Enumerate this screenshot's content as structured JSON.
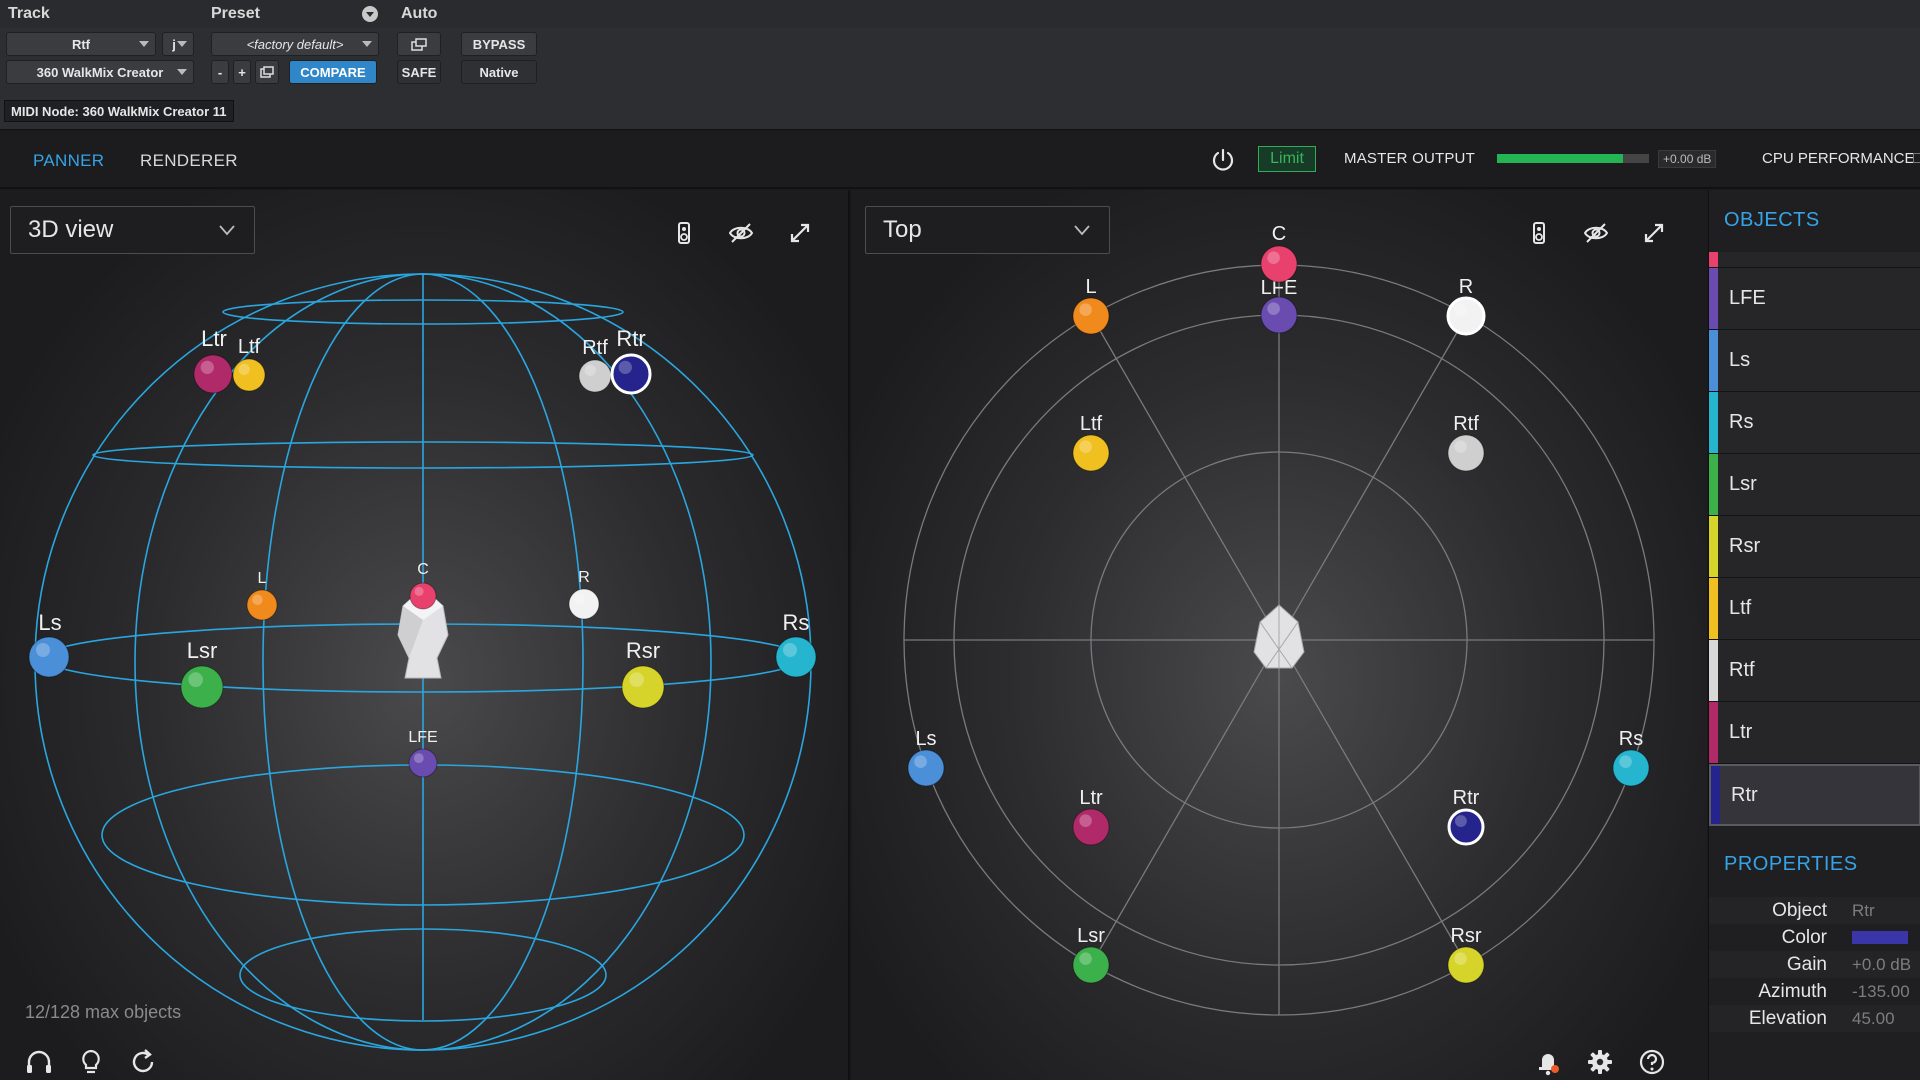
{
  "host": {
    "labels": {
      "track": "Track",
      "preset": "Preset",
      "auto": "Auto"
    },
    "track_name": "Rtf",
    "track_mode": "j",
    "plugin_name": "360 WalkMix Creator",
    "preset_name": "<factory default>",
    "minus": "-",
    "plus": "+",
    "compare": "COMPARE",
    "bypass": "BYPASS",
    "safe": "SAFE",
    "native": "Native",
    "midi_node": "MIDI Node: 360 WalkMix Creator 11"
  },
  "appbar": {
    "tabs": [
      {
        "label": "PANNER",
        "active": true
      },
      {
        "label": "RENDERER",
        "active": false
      }
    ],
    "limit": "Limit",
    "master_output": "MASTER OUTPUT",
    "meter_level": 0.83,
    "meter_value": "+0.00 dB",
    "cpu_performance": "CPU PERFORMANCE"
  },
  "left_view": {
    "selector": "3D view",
    "status": "12/128 max objects"
  },
  "right_view": {
    "selector": "Top"
  },
  "objects_heading": "OBJECTS",
  "objects": [
    {
      "name": "",
      "color": "#e8416e"
    },
    {
      "name": "LFE",
      "color": "#6a4cb0"
    },
    {
      "name": "Ls",
      "color": "#4a8fd8"
    },
    {
      "name": "Rs",
      "color": "#26b5cf"
    },
    {
      "name": "Lsr",
      "color": "#3bb04b"
    },
    {
      "name": "Rsr",
      "color": "#d6d42a"
    },
    {
      "name": "Ltf",
      "color": "#f0c020"
    },
    {
      "name": "Rtf",
      "color": "#d8d8d8"
    },
    {
      "name": "Ltr",
      "color": "#b02a6a"
    },
    {
      "name": "Rtr",
      "color": "#25248c"
    }
  ],
  "selected_object": "Rtr",
  "properties_heading": "PROPERTIES",
  "properties": {
    "object_label": "Object",
    "object_value": "Rtr",
    "color_label": "Color",
    "color_value": "#3a35a8",
    "gain_label": "Gain",
    "gain_value": "+0.0 dB",
    "azimuth_label": "Azimuth",
    "azimuth_value": "-135.00",
    "elevation_label": "Elevation",
    "elevation_value": "45.00"
  },
  "speakers": {
    "C": "C",
    "L": "L",
    "R": "R",
    "LFE": "LFE",
    "Ls": "Ls",
    "Rs": "Rs",
    "Lsr": "Lsr",
    "Rsr": "Rsr",
    "Ltf": "Ltf",
    "Rtf": "Rtf",
    "Ltr": "Ltr",
    "Rtr": "Rtr"
  },
  "colors": {
    "accent": "#36a3e6",
    "sphere_lines": "#2aa6df",
    "C": "#e8416e",
    "L": "#f08a1c",
    "R": "#f2f2f2",
    "LFE": "#6a4cb0",
    "Ls": "#4a8fd8",
    "Rs": "#26b5cf",
    "Lsr": "#3bb04b",
    "Rsr": "#d6d42a",
    "Ltf": "#f0c020",
    "Rtf": "#cfcfcf",
    "Ltr": "#b02a6a",
    "Rtr": "#25248c"
  },
  "icons": [
    "speaker-icon",
    "eye-off-icon",
    "expand-icon",
    "chevron-down-icon",
    "power-icon",
    "headphones-icon",
    "lightbulb-icon",
    "refresh-icon",
    "notification-icon",
    "gear-icon",
    "help-icon"
  ]
}
